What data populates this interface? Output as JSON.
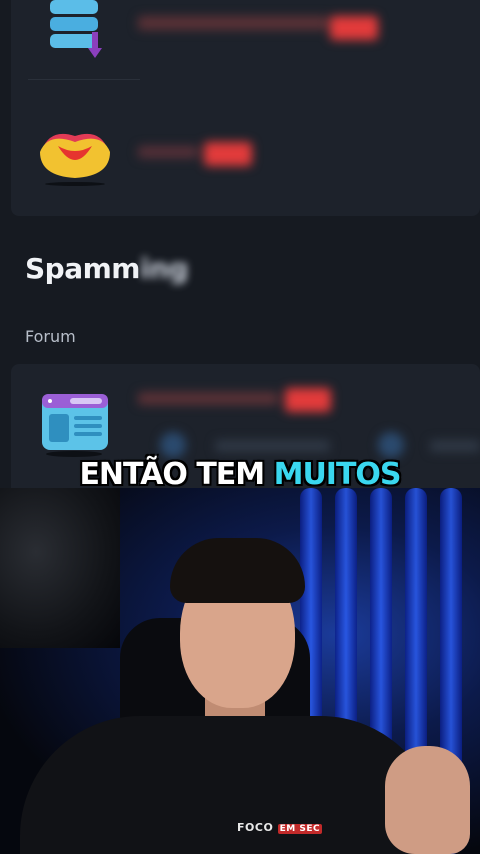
{
  "ui": {
    "section_title_visible": "Spamm",
    "section_title_blurred": "ing",
    "subsection_label": "Forum"
  },
  "caption": {
    "part1": "ENTÃO TEM ",
    "part2_highlight": "MUITOS"
  },
  "shirt_logo": {
    "brand": "FOCO",
    "badge": "EM SEC"
  },
  "icons": [
    "database-download-icon",
    "lips-icon",
    "browser-window-icon"
  ],
  "colors": {
    "badge_red": "#e23b3b",
    "caption_highlight": "#3ad7ef",
    "background_dark": "#161a21"
  }
}
